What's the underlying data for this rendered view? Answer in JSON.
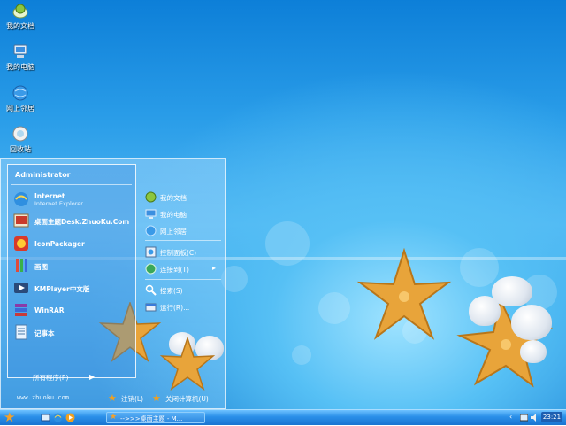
{
  "desktop": {
    "icons": [
      {
        "label": "我的文档",
        "icon": "documents-icon"
      },
      {
        "label": "我的电脑",
        "icon": "computer-icon"
      },
      {
        "label": "网上邻居",
        "icon": "network-icon"
      },
      {
        "label": "回收站",
        "icon": "recycle-bin-icon"
      }
    ]
  },
  "start_menu": {
    "user": "Administrator",
    "programs": [
      {
        "label": "Internet",
        "sub": "Internet Explorer",
        "icon": "internet-explorer-icon"
      },
      {
        "label": "桌面主题Desk.ZhuoKu.Com",
        "icon": "theme-icon"
      },
      {
        "label": "IconPackager",
        "icon": "iconpackager-icon"
      },
      {
        "label": "画图",
        "icon": "paint-icon"
      },
      {
        "label": "KMPlayer中文版",
        "icon": "kmplayer-icon"
      },
      {
        "label": "WinRAR",
        "icon": "winrar-icon"
      },
      {
        "label": "记事本",
        "icon": "notepad-icon"
      }
    ],
    "all_programs": "所有程序(P)",
    "website": "www.zhuoku.com",
    "right_items": [
      {
        "label": "我的文档",
        "icon": "documents-icon"
      },
      {
        "label": "我的电脑",
        "icon": "computer-icon"
      },
      {
        "label": "网上邻居",
        "icon": "network-icon"
      },
      {
        "label": "控制面板(C)",
        "icon": "control-panel-icon"
      },
      {
        "label": "连接到(T)",
        "icon": "connect-icon"
      },
      {
        "label": "搜索(S)",
        "icon": "search-icon"
      },
      {
        "label": "运行(R)...",
        "icon": "run-icon"
      }
    ],
    "logoff": "注销(L)",
    "shutdown": "关闭计算机(U)"
  },
  "taskbar": {
    "task_label": "-->>>桌面主题 - M...",
    "clock": "23:21"
  },
  "colors": {
    "accent": "#f3a12b",
    "sky": "#2b9ee9",
    "taskbar": "#1a74d1"
  }
}
